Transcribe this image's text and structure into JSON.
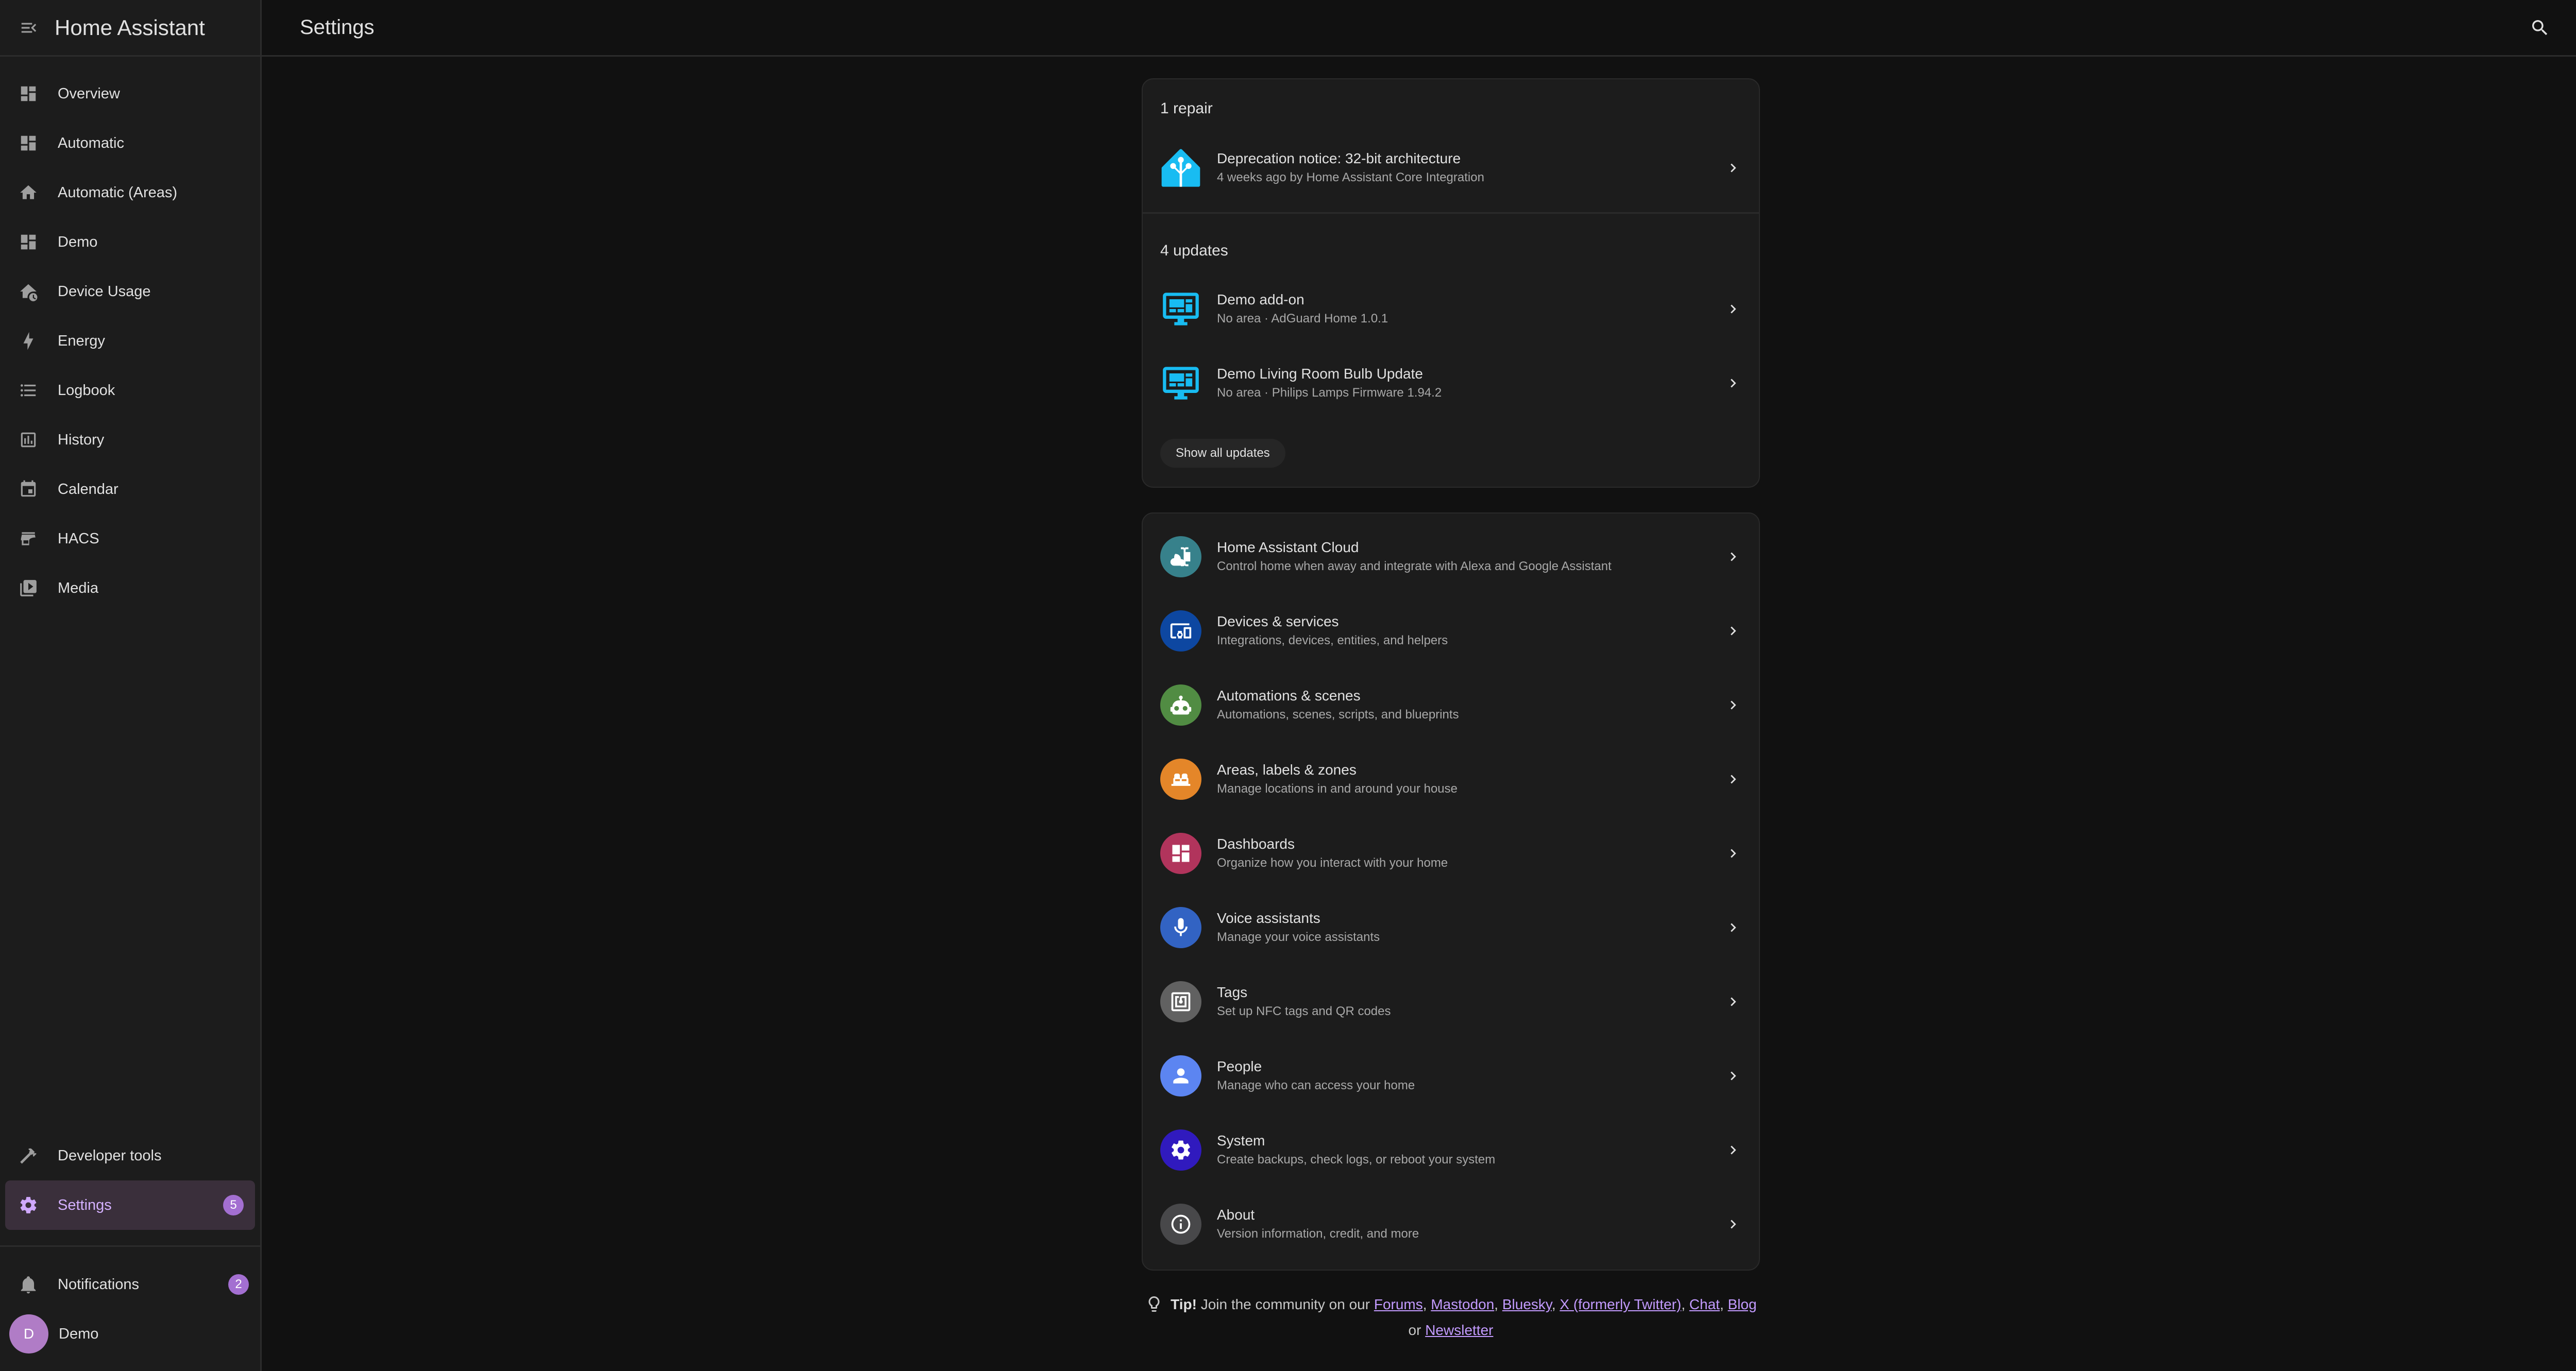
{
  "app": {
    "title": "Home Assistant"
  },
  "page": {
    "title": "Settings"
  },
  "sidebar": {
    "items": [
      {
        "label": "Overview",
        "icon": "dashboard-icon"
      },
      {
        "label": "Automatic",
        "icon": "dashboard-icon"
      },
      {
        "label": "Automatic (Areas)",
        "icon": "home-icon"
      },
      {
        "label": "Demo",
        "icon": "dashboard-icon"
      },
      {
        "label": "Device Usage",
        "icon": "home-clock-icon"
      },
      {
        "label": "Energy",
        "icon": "lightning-icon"
      },
      {
        "label": "Logbook",
        "icon": "list-icon"
      },
      {
        "label": "History",
        "icon": "chart-box-icon"
      },
      {
        "label": "Calendar",
        "icon": "calendar-icon"
      },
      {
        "label": "HACS",
        "icon": "store-icon"
      },
      {
        "label": "Media",
        "icon": "play-box-icon"
      }
    ],
    "developer_tools": "Developer tools",
    "settings": {
      "label": "Settings",
      "badge": "5"
    },
    "notifications": {
      "label": "Notifications",
      "badge": "2"
    },
    "user": {
      "name": "Demo",
      "initial": "D"
    }
  },
  "repairs": {
    "header": "1 repair",
    "items": [
      {
        "title": "Deprecation notice: 32-bit architecture",
        "subtitle": "4 weeks ago by Home Assistant Core Integration"
      }
    ]
  },
  "updates": {
    "header": "4 updates",
    "items": [
      {
        "title": "Demo add-on",
        "subtitle": "No area · AdGuard Home 1.0.1"
      },
      {
        "title": "Demo Living Room Bulb Update",
        "subtitle": "No area · Philips Lamps Firmware 1.94.2"
      }
    ],
    "show_all": "Show all updates"
  },
  "settings_items": [
    {
      "title": "Home Assistant Cloud",
      "subtitle": "Control home when away and integrate with Alexa and Google Assistant",
      "color": "#37818b",
      "icon": "cloud-lock-icon"
    },
    {
      "title": "Devices & services",
      "subtitle": "Integrations, devices, entities, and helpers",
      "color": "#0d47a1",
      "icon": "devices-icon"
    },
    {
      "title": "Automations & scenes",
      "subtitle": "Automations, scenes, scripts, and blueprints",
      "color": "#518c43",
      "icon": "robot-icon"
    },
    {
      "title": "Areas, labels & zones",
      "subtitle": "Manage locations in and around your house",
      "color": "#e48629",
      "icon": "sofa-icon"
    },
    {
      "title": "Dashboards",
      "subtitle": "Organize how you interact with your home",
      "color": "#b1345c",
      "icon": "view-dashboard-icon"
    },
    {
      "title": "Voice assistants",
      "subtitle": "Manage your voice assistants",
      "color": "#3263c3",
      "icon": "microphone-icon"
    },
    {
      "title": "Tags",
      "subtitle": "Set up NFC tags and QR codes",
      "color": "#616161",
      "icon": "nfc-icon"
    },
    {
      "title": "People",
      "subtitle": "Manage who can access your home",
      "color": "#5c85f1",
      "icon": "account-icon"
    },
    {
      "title": "System",
      "subtitle": "Create backups, check logs, or reboot your system",
      "color": "#301ABE",
      "icon": "cog-icon"
    },
    {
      "title": "About",
      "subtitle": "Version information, credit, and more",
      "color": "#48484a",
      "icon": "info-icon"
    }
  ],
  "tip": {
    "label": "Tip!",
    "text": "Join the community on our",
    "links": [
      "Forums",
      "Mastodon",
      "Bluesky",
      "X (formerly Twitter)",
      "Chat",
      "Blog"
    ],
    "or": "or",
    "last_link": "Newsletter"
  }
}
